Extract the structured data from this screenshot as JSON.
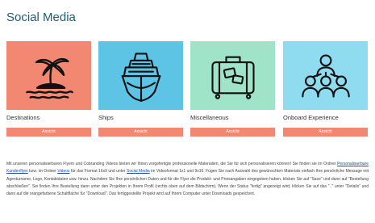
{
  "page": {
    "title": "Social Media"
  },
  "colors": {
    "title": "#1d5e73",
    "accent_button": "#f28872",
    "link": "#1d4fa0"
  },
  "cards": [
    {
      "label": "Destinations",
      "button": "Ansicht",
      "bg": "#f28872",
      "icon": "island-palm-icon"
    },
    {
      "label": "Ships",
      "button": "Ansicht",
      "bg": "#5ec4e6",
      "icon": "ship-icon"
    },
    {
      "label": "Miscellaneous",
      "button": "Ansicht",
      "bg": "#9fe3c9",
      "icon": "suitcase-icon"
    },
    {
      "label": "Onboard Experience",
      "button": "Ansicht",
      "bg": "#8fdcf0",
      "icon": "people-group-icon"
    }
  ],
  "description": {
    "p1": "Mit unseren personalisierbaren Flyern und Cobranding Videos bieten wir Ihnen vorgefertigte professionelle Materialien, die Sie für sich personalisieren können! Sie finden sie im Ordner ",
    "link1": "Personalisierbare Kundenflyer",
    "p2": " bzw. im Ordner ",
    "link2": "Videos",
    "p3": " für das Format 16x9 und unter ",
    "link3": "Social Media",
    "p4": " im Videoformat 1x1 und 9x16. Fügen Sie nach Auswahl des gewünschten Materials einfach Ihre persönliche Message mit Agenturname, Logo, Kontaktdaten usw. hinzu. Nachdem Sie Ihre persönlichen Daten und für die Flyer die Produkt- und Preisangaben eingegeben haben, klicken Sie auf \"Save\" und dann auf \"Bestellung abschließen\". Sie finden Ihre Bestellung dann unter den Projekten in Ihrem Profil (rechts oben auf dem Bildschirm). Wenn der Status \"fertig\" angezeigt wird, klicken Sie auf das \"..\" unter \"Details\" und dann auf die orangefarbene Schaltfläche für \"Download\". Das fertiggestellte Projekt wird auf Ihrem Computer unter Downloads gespeichert."
  }
}
